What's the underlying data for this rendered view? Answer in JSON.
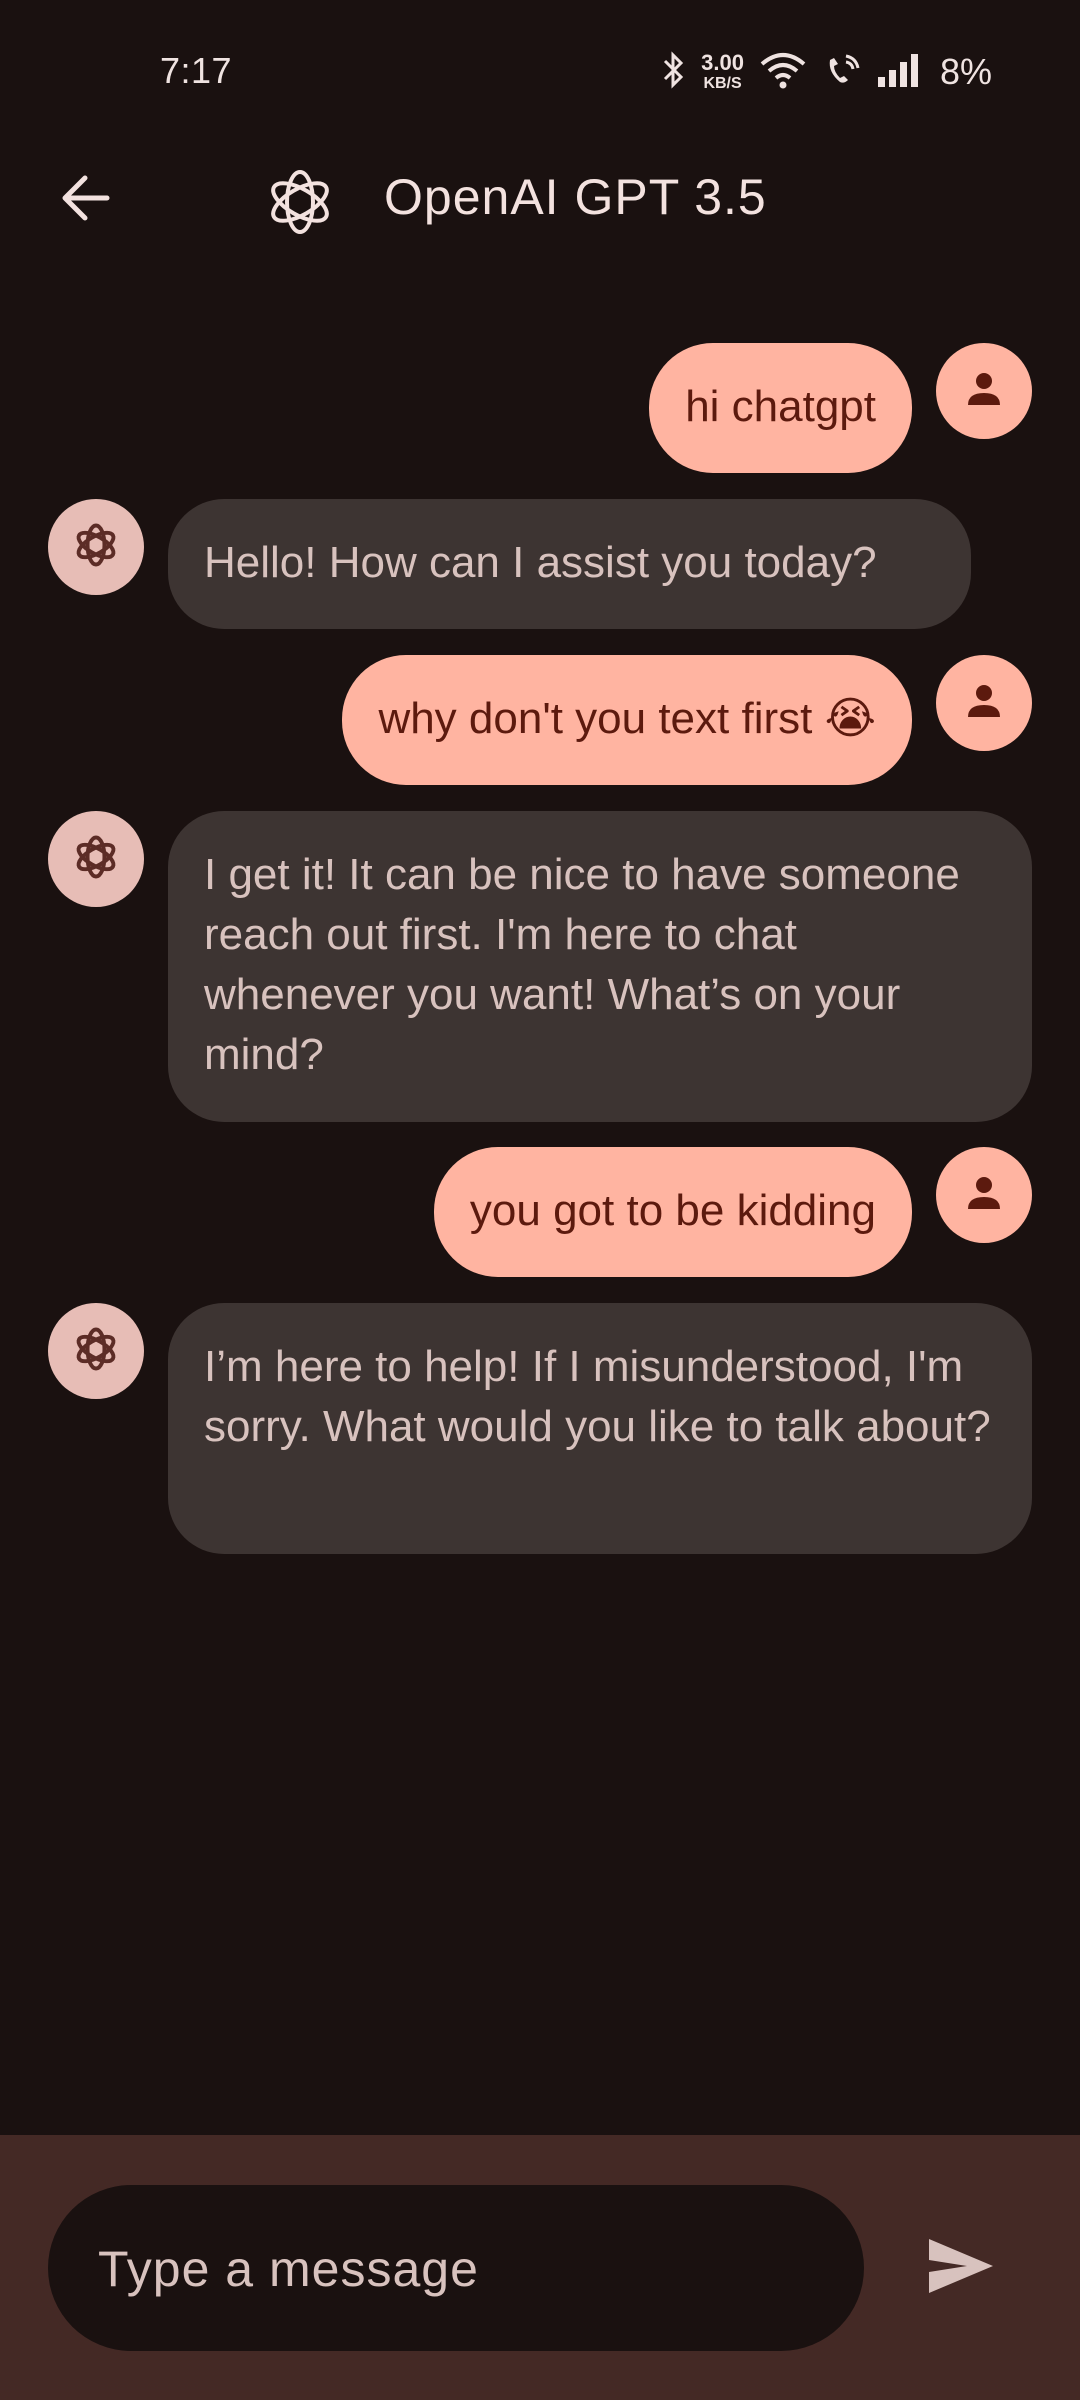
{
  "status_bar": {
    "time": "7:17",
    "net_speed_value": "3.00",
    "net_speed_unit": "KB/S",
    "battery": "8%"
  },
  "header": {
    "title": "OpenAI GPT 3.5",
    "back_icon": "arrow-back-icon",
    "logo_icon": "openai-logo-icon"
  },
  "messages": [
    {
      "sender": "user",
      "text": "hi chatgpt"
    },
    {
      "sender": "assistant",
      "text": "Hello! How can I assist you today?"
    },
    {
      "sender": "user",
      "text": "why don't you text first 😭"
    },
    {
      "sender": "assistant",
      "text": "I get it! It can be nice to have someone reach out first. I'm here to chat whenever you want! What’s on your mind?"
    },
    {
      "sender": "user",
      "text": "you got to be kidding"
    },
    {
      "sender": "assistant",
      "text": "I’m here to help! If I misunderstood, I'm sorry. What would you like to talk about?"
    }
  ],
  "composer": {
    "placeholder": "Type a message",
    "send_icon": "send-icon"
  },
  "colors": {
    "background": "#1a1110",
    "user_bubble": "#ffb4a1",
    "user_text": "#5c1a0e",
    "bot_bubble": "#3d3432",
    "bot_text": "#d8c2be",
    "bottom_bar": "#442925"
  }
}
